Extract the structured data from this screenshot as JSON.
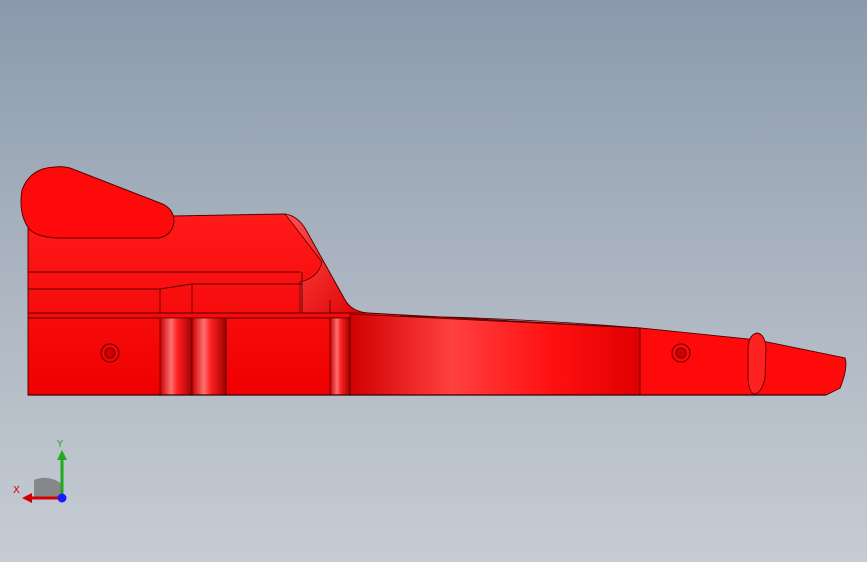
{
  "viewport": {
    "background_top": "#8a9aac",
    "background_bottom": "#c6ccd4"
  },
  "model": {
    "part_color": "#ff0000",
    "edge_color": "#5a0000"
  },
  "triad": {
    "x_label": "X",
    "y_label": "Y",
    "x_color": "#d40000",
    "y_color": "#1faa1f",
    "z_color": "#1a1aff"
  }
}
